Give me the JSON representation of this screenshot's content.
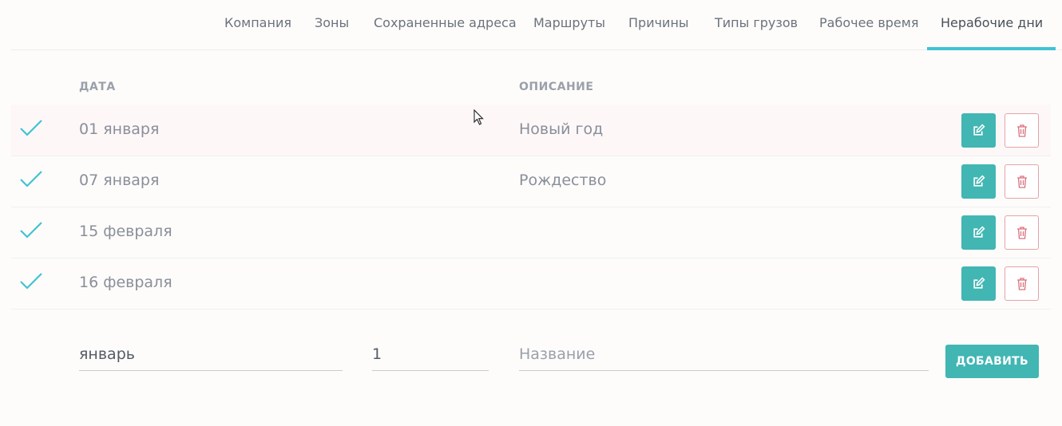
{
  "tabs": [
    {
      "label": "Компания"
    },
    {
      "label": "Зоны"
    },
    {
      "label": "Сохраненные адреса"
    },
    {
      "label": "Маршруты"
    },
    {
      "label": "Причины"
    },
    {
      "label": "Типы грузов"
    },
    {
      "label": "Рабочее время"
    },
    {
      "label": "Нерабочие дни",
      "active": true
    }
  ],
  "table": {
    "headers": {
      "date": "ДАТА",
      "description": "ОПИСАНИЕ"
    },
    "rows": [
      {
        "date": "01 января",
        "description": "Новый год",
        "checked": true
      },
      {
        "date": "07 января",
        "description": "Рождество",
        "checked": true
      },
      {
        "date": "15 февраля",
        "description": "",
        "checked": true
      },
      {
        "date": "16 февраля",
        "description": "",
        "checked": true
      }
    ]
  },
  "form": {
    "month_value": "январь",
    "day_value": "1",
    "name_placeholder": "Название",
    "add_label": "ДОБАВИТЬ"
  },
  "colors": {
    "accent": "#41c3d2",
    "button_teal": "#41b6b3",
    "delete_border": "#e3a3a9",
    "delete_icon": "#d9727d"
  },
  "icons": {
    "row_check": "checkmark-icon",
    "edit": "edit-icon",
    "delete": "trash-icon"
  }
}
